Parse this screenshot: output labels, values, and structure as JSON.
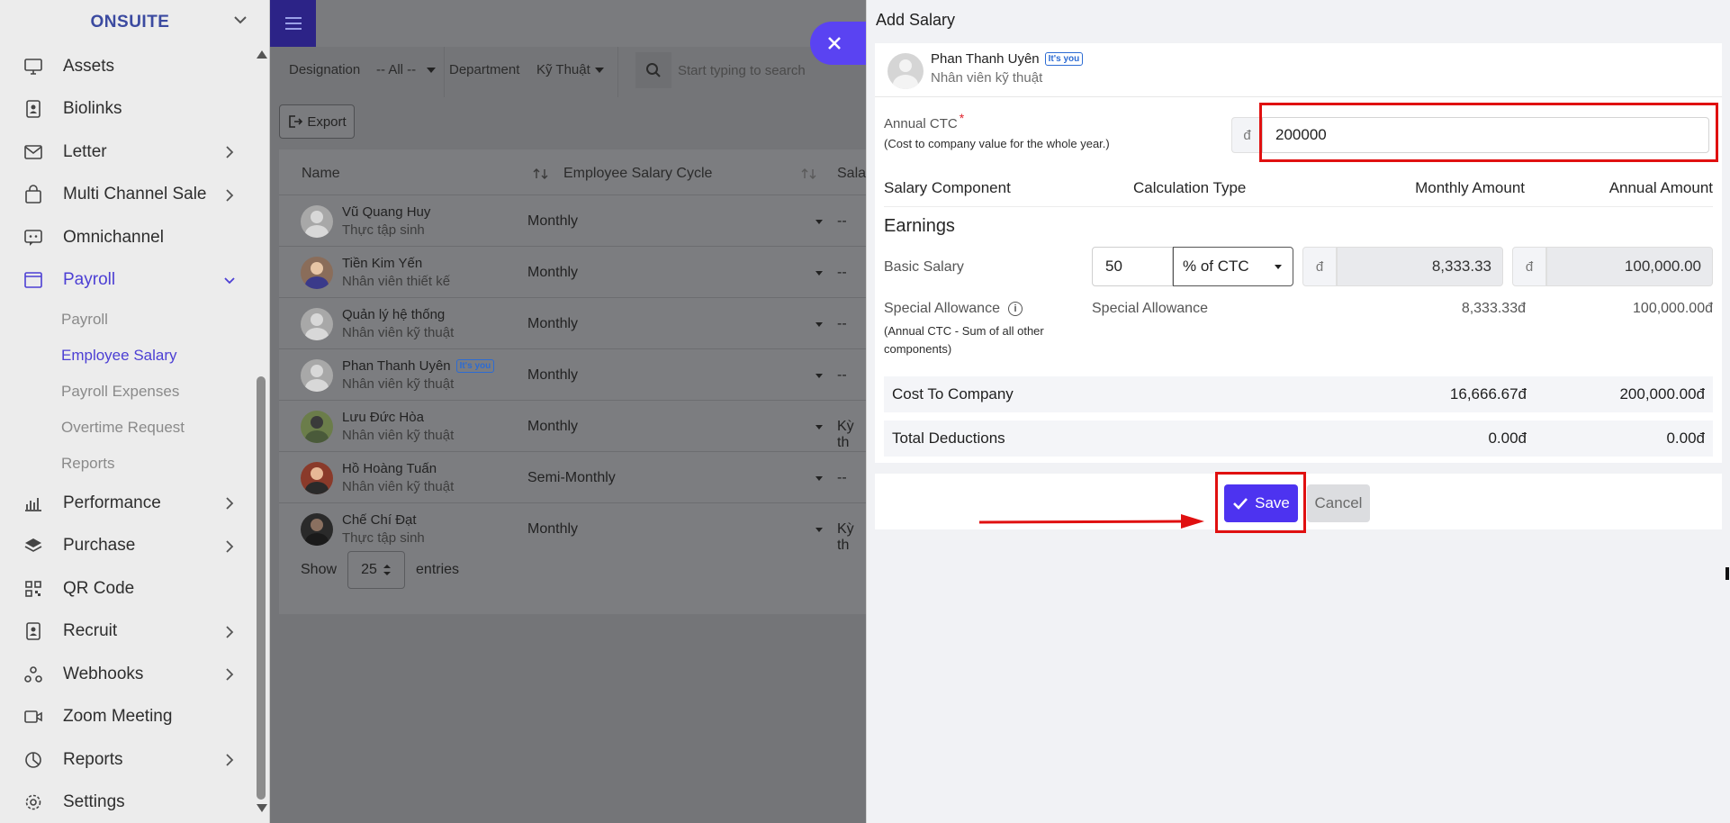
{
  "sidebar": {
    "brand": "ONSUITE",
    "items": [
      {
        "label": "Assets",
        "has_arrow": false
      },
      {
        "label": "Biolinks",
        "has_arrow": false
      },
      {
        "label": "Letter",
        "has_arrow": true
      },
      {
        "label": "Multi Channel Sale",
        "has_arrow": true
      },
      {
        "label": "Omnichannel",
        "has_arrow": false
      },
      {
        "label": "Payroll",
        "has_arrow": true,
        "active": true
      },
      {
        "label": "Performance",
        "has_arrow": true
      },
      {
        "label": "Purchase",
        "has_arrow": true
      },
      {
        "label": "QR Code",
        "has_arrow": false
      },
      {
        "label": "Recruit",
        "has_arrow": true
      },
      {
        "label": "Webhooks",
        "has_arrow": true
      },
      {
        "label": "Zoom Meeting",
        "has_arrow": false
      },
      {
        "label": "Reports",
        "has_arrow": true
      },
      {
        "label": "Settings",
        "has_arrow": false
      }
    ],
    "payroll_sub": [
      "Payroll",
      "Employee Salary",
      "Payroll Expenses",
      "Overtime Request",
      "Reports"
    ],
    "active_sub": "Employee Salary"
  },
  "filters": {
    "designation_label": "Designation",
    "designation_value": "-- All --",
    "department_label": "Department",
    "department_value": "Kỹ Thuật",
    "search_placeholder": "Start typing to search"
  },
  "toolbar": {
    "export_label": "Export"
  },
  "table": {
    "headers": [
      "Name",
      "Employee Salary Cycle",
      "Salar"
    ],
    "rows": [
      {
        "name": "Vũ Quang Huy",
        "role": "Thực tập sinh",
        "cycle": "Monthly",
        "salary": "--",
        "you": false
      },
      {
        "name": "Tiền Kim Yến",
        "role": "Nhân viên thiết kế",
        "cycle": "Monthly",
        "salary": "--",
        "you": false
      },
      {
        "name": "Quản lý hệ thống",
        "role": "Nhân viên kỹ thuật",
        "cycle": "Monthly",
        "salary": "--",
        "you": false
      },
      {
        "name": "Phan Thanh Uyên",
        "role": "Nhân viên kỹ thuật",
        "cycle": "Monthly",
        "salary": "--",
        "you": true
      },
      {
        "name": "Lưu Đức Hòa",
        "role": "Nhân viên kỹ thuật",
        "cycle": "Monthly",
        "salary": "Kỳ th",
        "you": false
      },
      {
        "name": "Hồ Hoàng Tuấn",
        "role": "Nhân viên kỹ thuật",
        "cycle": "Semi-Monthly",
        "salary": "--",
        "you": false
      },
      {
        "name": "Chế Chí Đạt",
        "role": "Thực tập sinh",
        "cycle": "Monthly",
        "salary": "Kỳ th",
        "you": false
      }
    ],
    "you_badge": "It's you",
    "show_label": "Show",
    "entries_value": "25",
    "entries_label": "entries"
  },
  "drawer": {
    "title": "Add Salary",
    "employee": {
      "name": "Phan Thanh Uyên",
      "role": "Nhân viên kỹ thuật",
      "badge": "It's you"
    },
    "ctc_label": "Annual CTC",
    "ctc_required": "*",
    "ctc_help": "(Cost to company value for the whole year.)",
    "currency": "đ",
    "ctc_value": "200000",
    "columns": [
      "Salary Component",
      "Calculation Type",
      "Monthly Amount",
      "Annual Amount"
    ],
    "earnings_label": "Earnings",
    "basic": {
      "label": "Basic Salary",
      "percent": "50",
      "calc_type": "% of CTC",
      "monthly": "8,333.33",
      "annual": "100,000.00"
    },
    "special": {
      "label": "Special Allowance",
      "help": "(Annual CTC - Sum of all other components)",
      "calc_type": "Special Allowance",
      "monthly": "8,333.33đ",
      "annual": "100,000.00đ"
    },
    "cost_to_company": {
      "label": "Cost To Company",
      "monthly": "16,666.67đ",
      "annual": "200,000.00đ"
    },
    "total_deductions": {
      "label": "Total Deductions",
      "monthly": "0.00đ",
      "annual": "0.00đ"
    },
    "save_label": "Save",
    "cancel_label": "Cancel"
  },
  "colors": {
    "accent": "#4d33f0",
    "highlight": "#e01010",
    "active_nav": "#4c3fd4"
  }
}
